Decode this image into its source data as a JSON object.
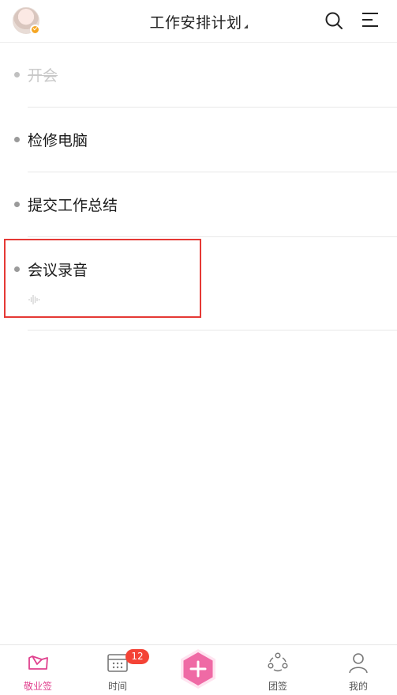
{
  "header": {
    "title": "工作安排计划",
    "icons": {
      "avatar": "user-avatar",
      "search": "search-icon",
      "menu": "menu-icon"
    }
  },
  "list": {
    "items": [
      {
        "label": "开会",
        "completed": true
      },
      {
        "label": "检修电脑",
        "completed": false
      },
      {
        "label": "提交工作总结",
        "completed": false
      },
      {
        "label": "会议录音",
        "completed": false,
        "attachment": "audio-wave-icon"
      }
    ]
  },
  "tabbar": {
    "tabs": [
      {
        "label": "敬业签",
        "icon": "note-icon",
        "active": true
      },
      {
        "label": "时间",
        "icon": "calendar-icon",
        "active": false
      },
      {
        "label": "团签",
        "icon": "team-icon",
        "active": false
      },
      {
        "label": "我的",
        "icon": "profile-icon",
        "active": false
      }
    ],
    "calendar_badge": "12",
    "add_icon": "plus-icon"
  },
  "colors": {
    "accent": "#e0418e",
    "add_button": "#ef6aa5",
    "badge": "#f44336",
    "highlight": "#e53935"
  }
}
